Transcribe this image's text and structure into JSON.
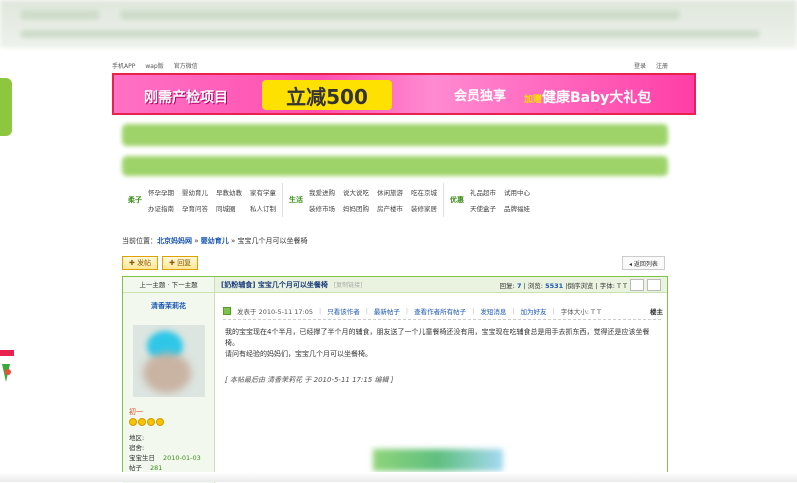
{
  "topbar": {
    "links": [
      "手机APP",
      "wap版",
      "官方微信"
    ],
    "right_links": [
      "登录",
      "注册"
    ]
  },
  "banner": {
    "part1": "刚需产检项目",
    "part2": "立减500",
    "part3": "会员独享",
    "part4_small": "加赠",
    "part4": "健康Baby大礼包",
    "border_color": "#e8224d"
  },
  "nav": {
    "col1": {
      "head": "柔子",
      "items": [
        "怀孕孕期",
        "婴幼育儿",
        "早教幼教",
        "家有学童",
        "办证指南",
        "孕育问答",
        "同城圈",
        "私人订制"
      ]
    },
    "col2": {
      "head": "生活",
      "items": [
        "我爱进购",
        "说大说吃",
        "休闲旅游",
        "吃在京城",
        "装修市场",
        "妈妈团购",
        "房产楼市",
        "装修家居"
      ]
    },
    "col3": {
      "head": "优惠",
      "items": [
        "礼品超市",
        "试用中心",
        "天使盒子",
        "品牌福娃"
      ]
    }
  },
  "breadcrumb": {
    "label": "当前位置：",
    "site": "北京妈妈网",
    "section": "婴幼育儿",
    "current": "宝宝几个月可以坐餐椅"
  },
  "buttons": {
    "post": "发帖",
    "reply": "回复",
    "back": "返回列表"
  },
  "post": {
    "prev_next": "上一主题 · 下一主题",
    "author": "清香茉莉花",
    "rank": "初一",
    "meta": [
      {
        "label": "地区:",
        "value": ""
      },
      {
        "label": "宿舍:",
        "value": ""
      },
      {
        "label": "宝宝生日",
        "value": "2010-01-03"
      },
      {
        "label": "帖子",
        "value": "281"
      }
    ],
    "title": "[奶粉辅食] 宝宝几个月可以坐餐椅",
    "title_tag": "[复制链接]",
    "stats_prefix": "回复: ",
    "replies": "7",
    "stats_mid": " | 浏览: ",
    "views": "5531",
    "stats_suffix": " |倒序浏览 | 字体: T T",
    "posted": "发表于 2010-5-11 17:05",
    "links": [
      "只看该作者",
      "最新帖子",
      "查看作者所有帖子",
      "发短消息",
      "加为好友"
    ],
    "font_label": "字体大小: T T",
    "floor": "楼主",
    "body_line1": "我的宝宝现在4个半月，已经撑了半个月的辅食，朋友送了一个儿童餐椅还没有用，宝宝现在吃辅食总是用手去抓东西，觉得还是应该坐餐椅。",
    "body_line2": "请问有经验的妈妈们，宝宝几个月可以坐餐椅。",
    "edit_note": "[ 本帖最后由 清香茉莉花 于 2010-5-11 17:15 编辑 ]"
  }
}
